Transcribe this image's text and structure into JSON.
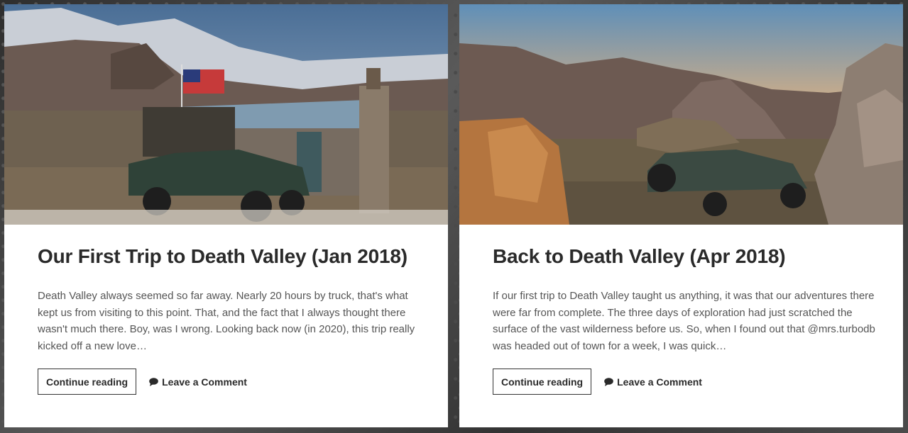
{
  "posts": [
    {
      "title": "Our First Trip to Death Valley (Jan 2018)",
      "excerpt": "Death Valley always seemed so far away. Nearly 20 hours by truck, that's what kept us from visiting to this point. That, and the fact that I always thought there wasn't much there. Boy, was I wrong. Looking back now (in 2020), this trip really kicked off a new love…",
      "button_label": "Continue reading",
      "comment_label": "Leave a Comment"
    },
    {
      "title": "Back to Death Valley (Apr 2018)",
      "excerpt": "If our first trip to Death Valley taught us anything, it was that our adventures there were far from complete. The three days of exploration had just scratched the surface of the vast wilderness before us. So, when I found out that @mrs.turbodb was headed out of town for a week, I was quick…",
      "button_label": "Continue reading",
      "comment_label": "Leave a Comment"
    }
  ],
  "icons": {
    "comment": "speech-bubble-icon"
  },
  "colors": {
    "text": "#2a2a2a",
    "excerpt": "#555555",
    "card": "#ffffff"
  }
}
